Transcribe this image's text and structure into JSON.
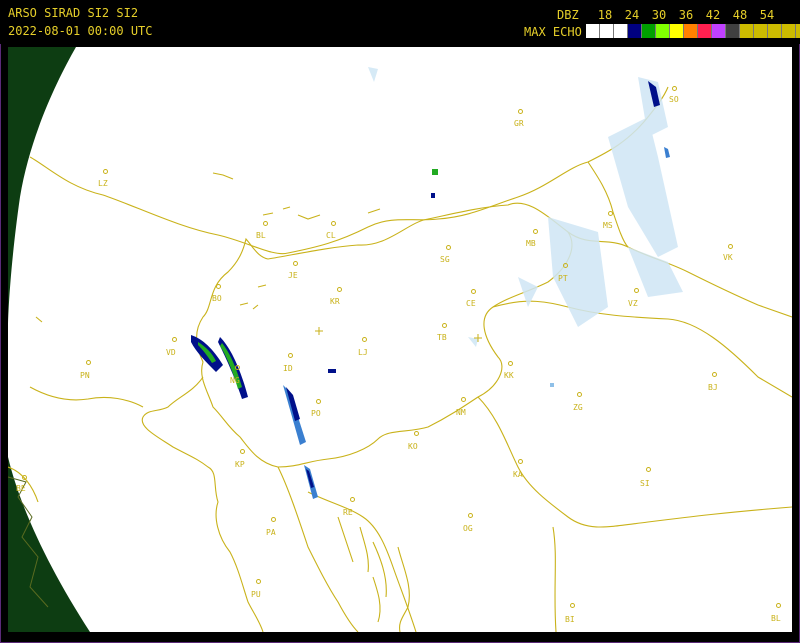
{
  "header": {
    "title": "ARSO SIRAD SI2 SI2",
    "timestamp": "2022-08-01 00:00 UTC",
    "dbz_label": "DBZ",
    "max_echo_label": "MAX ECHO"
  },
  "legend": {
    "ticks": [
      "18",
      "24",
      "30",
      "36",
      "42",
      "48",
      "54"
    ],
    "colors": [
      "#ffffff",
      "#ffffff",
      "#ffffff",
      "#000080",
      "#00a000",
      "#80ff00",
      "#ffff00",
      "#ff8000",
      "#ff2050",
      "#c040ff",
      "#404040",
      "#ccbb00",
      "#ccbb00",
      "#ccbb00",
      "#ccbb00",
      "#ccbb00"
    ]
  },
  "colors": {
    "border_line": "#c9b21a",
    "land_outside_range": "#0d3d12",
    "map_background": "#ffffff",
    "echo_light": "#cfe6f5",
    "echo_medium": "#3a7fd0",
    "echo_strong": "#00108a",
    "echo_green": "#22aa22"
  },
  "stations": [
    {
      "code": "SO"
    },
    {
      "code": "GR"
    },
    {
      "code": "LZ"
    },
    {
      "code": "BL"
    },
    {
      "code": "CL"
    },
    {
      "code": "MS"
    },
    {
      "code": "VK"
    },
    {
      "code": "MB"
    },
    {
      "code": "SG"
    },
    {
      "code": "JE"
    },
    {
      "code": "PT"
    },
    {
      "code": "BO"
    },
    {
      "code": "KR"
    },
    {
      "code": "CE"
    },
    {
      "code": "VZ"
    },
    {
      "code": "VD"
    },
    {
      "code": "TB"
    },
    {
      "code": "LJ"
    },
    {
      "code": "PN"
    },
    {
      "code": "NG"
    },
    {
      "code": "ID"
    },
    {
      "code": "KK"
    },
    {
      "code": "BJ"
    },
    {
      "code": "PO"
    },
    {
      "code": "ZG"
    },
    {
      "code": "NM"
    },
    {
      "code": "KO"
    },
    {
      "code": "KP"
    },
    {
      "code": "KA"
    },
    {
      "code": "SI"
    },
    {
      "code": "BE"
    },
    {
      "code": "RE"
    },
    {
      "code": "PA"
    },
    {
      "code": "OG"
    },
    {
      "code": "PU"
    },
    {
      "code": "BI"
    },
    {
      "code": "BL"
    }
  ]
}
